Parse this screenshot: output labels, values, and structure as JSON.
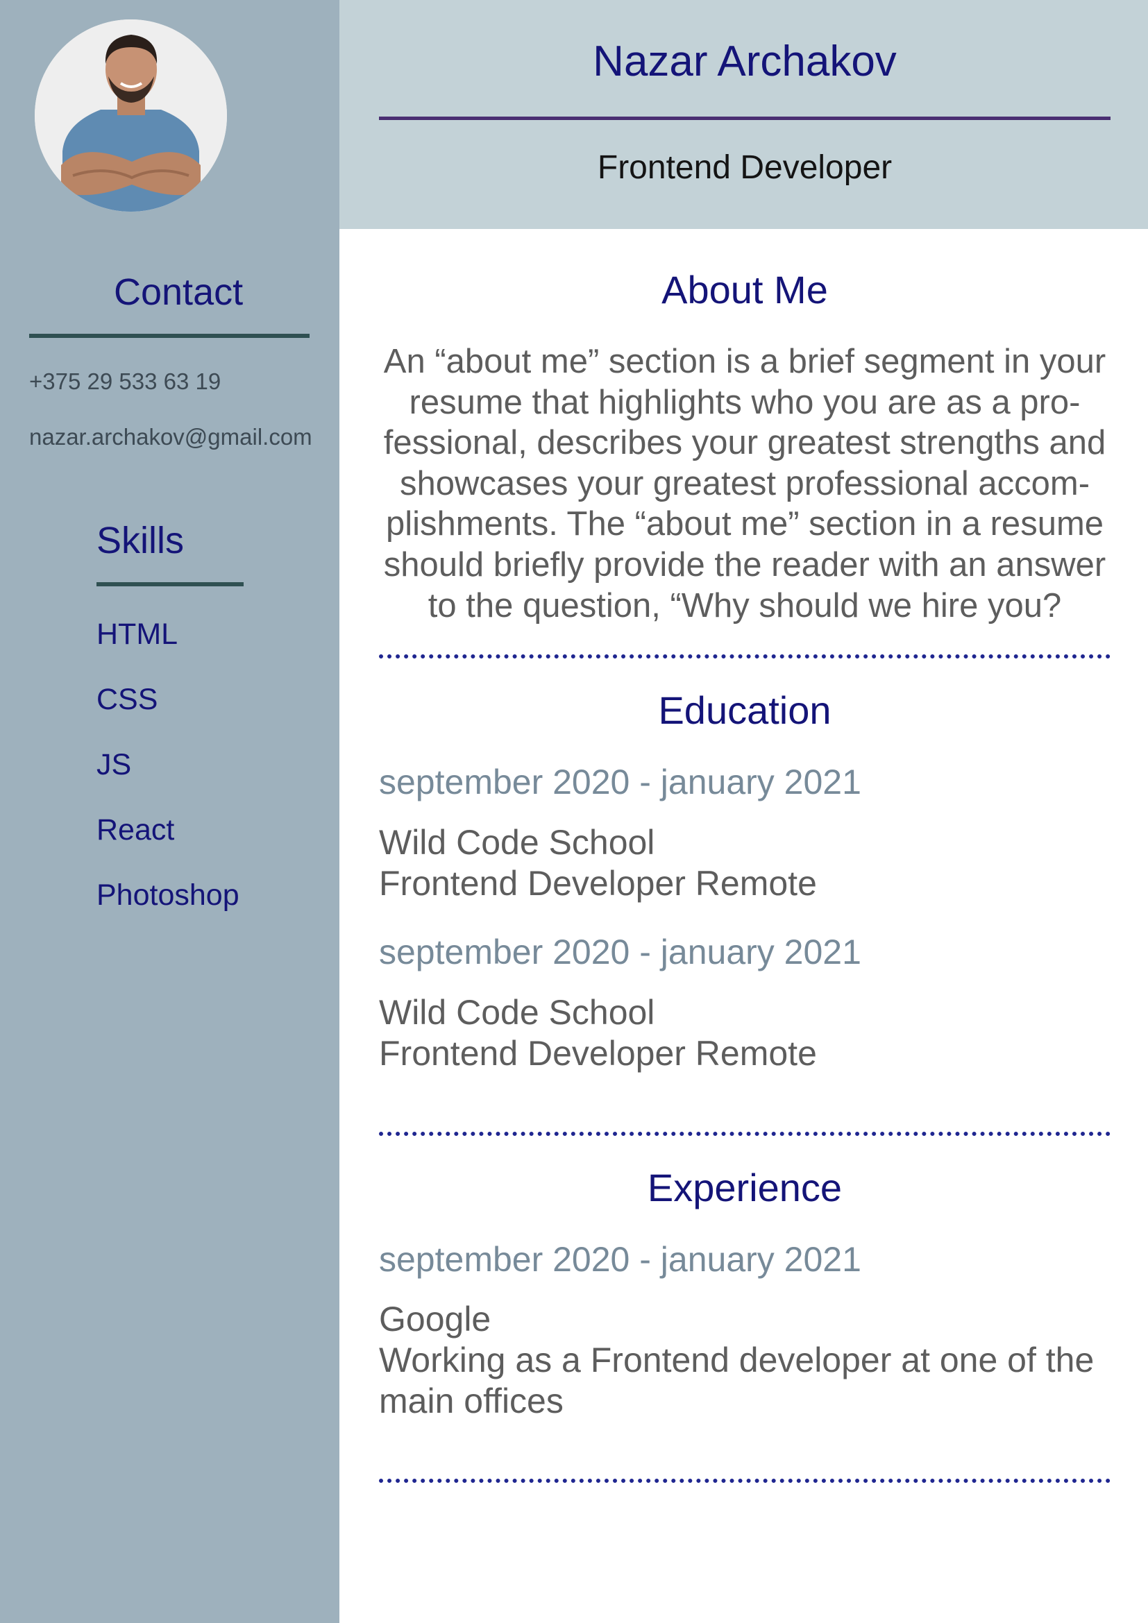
{
  "header": {
    "name": "Nazar Archakov",
    "role": "Frontend Developer"
  },
  "sidebar": {
    "photo_icon": "person-photo",
    "contact": {
      "title": "Contact",
      "phone": "+375 29 533 63 19",
      "email": "nazar.archakov@gmail.com"
    },
    "skills": {
      "title": "Skills",
      "items": [
        "HTML",
        "CSS",
        "JS",
        "React",
        "Photoshop"
      ]
    }
  },
  "about": {
    "title": "About Me",
    "lines": [
      "An “about me” section is a brief segment in your",
      "resume that highlights who you are as a pro-",
      "fessional, describes your greatest strengths and",
      "showcases your greatest professional accom-",
      "plishments. The “about me” section in a resume",
      "should briefly provide the reader with an answer",
      "to the question, “Why should we hire you?"
    ]
  },
  "education": {
    "title": "Education",
    "entries": [
      {
        "date": "september 2020 - january 2021",
        "place": "Wild Code School",
        "desc": "Frontend Developer Remote"
      },
      {
        "date": "september 2020 - january 2021",
        "place": "Wild Code School",
        "desc": "Frontend Developer Remote"
      }
    ]
  },
  "experience": {
    "title": "Experience",
    "entries": [
      {
        "date": "september 2020 - january 2021",
        "place": "Google",
        "desc_lines": [
          "Working as a Frontend developer at one of the",
          "main offices"
        ]
      }
    ]
  },
  "colors": {
    "sidebar_bg": "#9eb1bd",
    "header_bg": "#c3d2d7",
    "accent_navy": "#141478",
    "date_gray": "#778a99"
  }
}
